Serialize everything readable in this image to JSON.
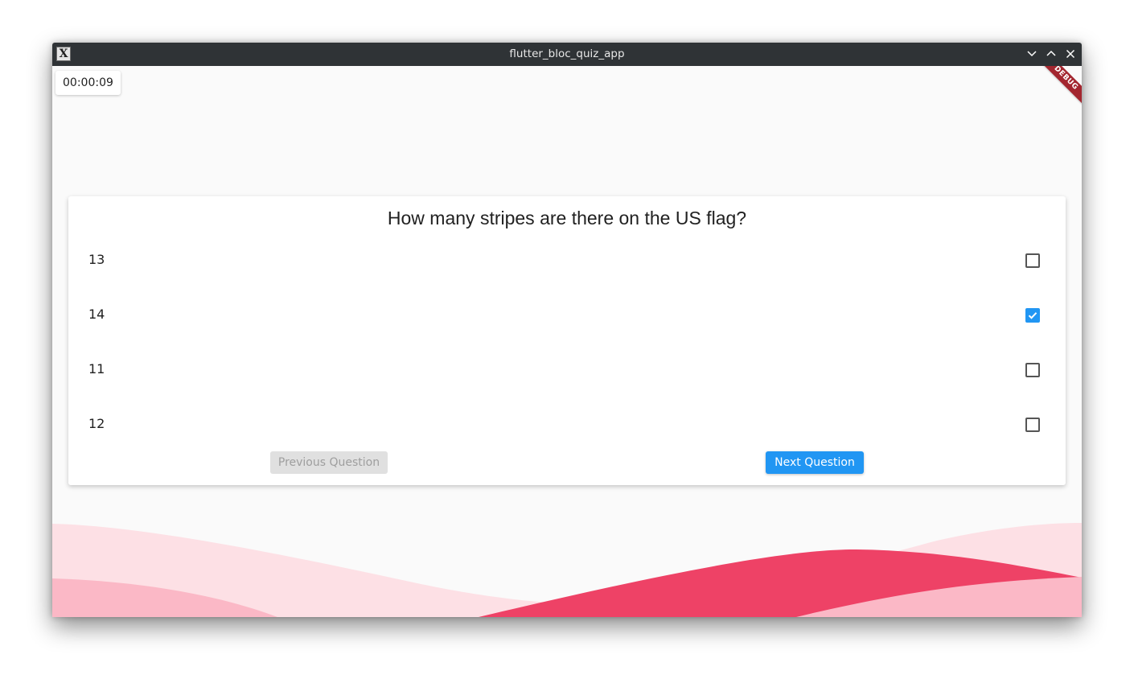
{
  "window": {
    "title": "flutter_bloc_quiz_app",
    "icon": "x-app-icon",
    "controls": [
      "minimize-icon",
      "maximize-icon",
      "close-icon"
    ]
  },
  "timer": {
    "value": "00:00:09"
  },
  "banner": {
    "label": "DEBUG"
  },
  "quiz": {
    "question": "How many stripes are there on the US flag?",
    "options": [
      {
        "label": "13",
        "checked": false
      },
      {
        "label": "14",
        "checked": true
      },
      {
        "label": "11",
        "checked": false
      },
      {
        "label": "12",
        "checked": false
      }
    ],
    "previous_label": "Previous Question",
    "previous_enabled": false,
    "next_label": "Next Question"
  },
  "colors": {
    "accent": "#2196f3",
    "wave_light": "#fde0e5",
    "wave_mid": "#fbb8c6",
    "wave_dark": "#ee4266",
    "titlebar": "#2f3336"
  }
}
